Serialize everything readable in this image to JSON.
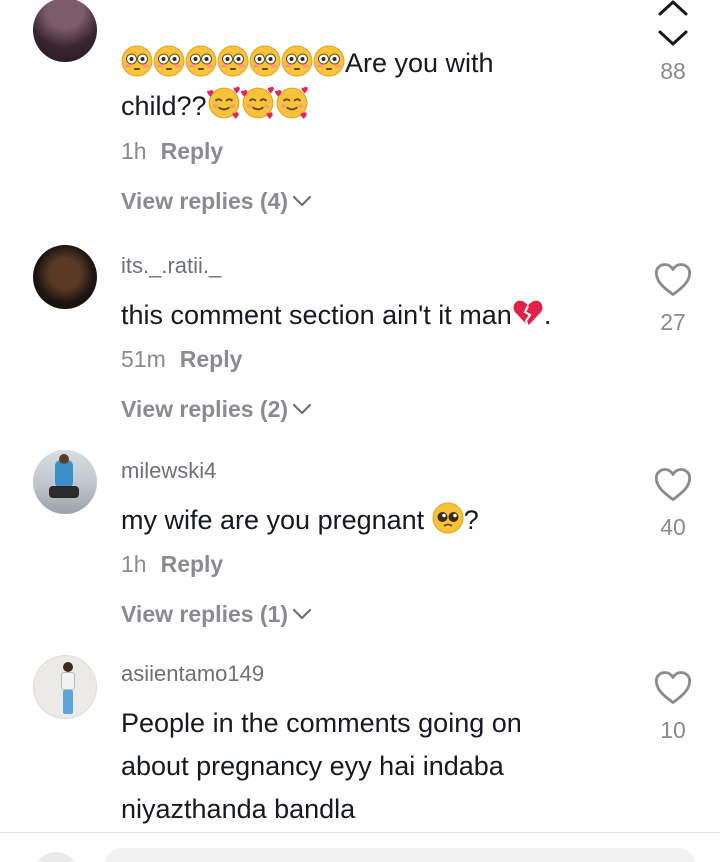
{
  "comments": [
    {
      "text_before": "",
      "text_line1": "Are you with",
      "text_line2": "child??",
      "time": "1h",
      "reply_label": "Reply",
      "view_replies": "View replies (4)",
      "likes": "88"
    },
    {
      "username": "its._.ratii._",
      "text": "this comment section ain't it man",
      "text_after": ".",
      "time": "51m",
      "reply_label": "Reply",
      "view_replies": "View replies (2)",
      "likes": "27"
    },
    {
      "username": "milewski4",
      "text": "my wife are you pregnant",
      "text_after": "?",
      "time": "1h",
      "reply_label": "Reply",
      "view_replies": "View replies (1)",
      "likes": "40"
    },
    {
      "username": "asiientamo149",
      "text_line1": "People in the comments going on",
      "text_line2": "about pregnancy eyy hai indaba",
      "text_line3": "niyazthanda bandla",
      "likes": "10"
    }
  ],
  "icons": {
    "flushed_emoji": "flushed-face",
    "love_emoji": "smiling-face-with-hearts",
    "broken_heart_emoji": "broken-heart",
    "pleading_emoji": "pleading-face",
    "like_icon": "heart-outline",
    "chevron_up": "chevron-up",
    "chevron_down": "chevron-down"
  },
  "colors": {
    "text": "#161823",
    "muted": "#8a8b91",
    "username": "#6e7079",
    "emoji_yellow": "#f7c33b"
  }
}
